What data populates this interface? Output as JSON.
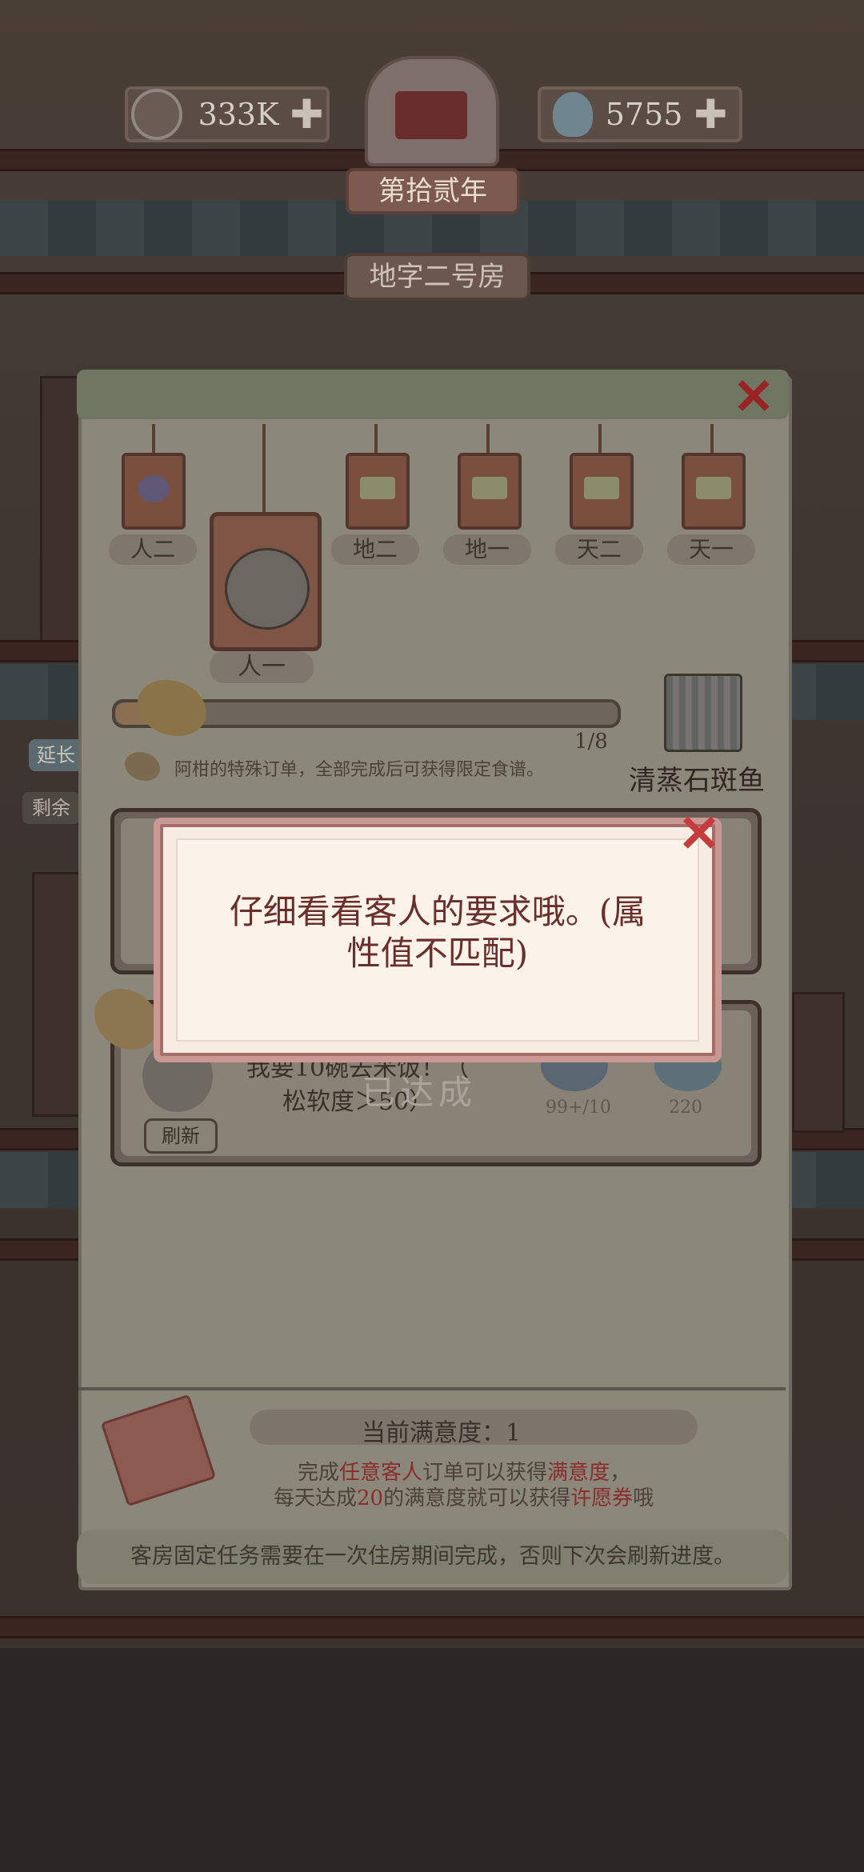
{
  "header": {
    "coins": "333K",
    "gems": "5755",
    "year": "第拾贰年",
    "room": "地字二号房"
  },
  "panel": {
    "tags": [
      "人二",
      "地二",
      "地一",
      "天二",
      "天一"
    ],
    "selected_tag": "人一",
    "progress": {
      "text": "1/8",
      "fraction": 0.125
    },
    "hint": "阿柑的特殊订单，全部完成后可获得限定食谱。",
    "recipe_name": "清蒸石斑鱼",
    "order": {
      "text_line1": "我要10碗去米饭！（",
      "text_line2": "松软度＞50）",
      "status": "已达成",
      "value1": "99+/10",
      "value2": "220",
      "refresh": "刷新"
    },
    "satisfaction": {
      "title": "当前满意度：1",
      "line1_a": "完成",
      "line1_b": "任意客人",
      "line1_c": "订单可以获得",
      "line1_d": "满意度",
      "line1_e": "，",
      "line2_a": "每天达成",
      "line2_b": "20",
      "line2_c": "的满意度就可以获得",
      "line2_d": "许愿券",
      "line2_e": "哦"
    },
    "bottom_note": "客房固定任务需要在一次住房期间完成，否则下次会刷新进度。"
  },
  "dialog": {
    "message_line1": "仔细看看客人的要求哦。(属",
    "message_line2": "性值不匹配)"
  },
  "side": {
    "left_label1": "延长",
    "left_label2": "剩余"
  },
  "colors": {
    "dialog_border": "#c99892",
    "dialog_text": "#6a2f2a",
    "close_red": "#c63b3b",
    "highlight_red": "#8a2c2c"
  }
}
